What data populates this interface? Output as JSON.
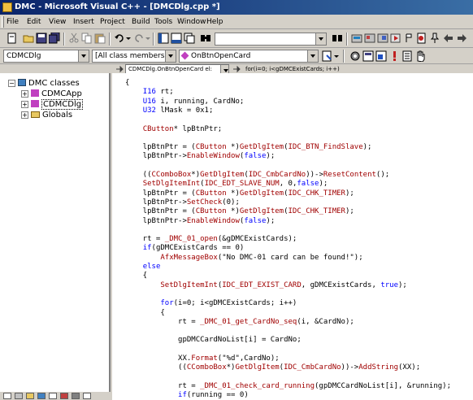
{
  "window": {
    "title": "DMC - Microsoft Visual C++ - [DMCDlg.cpp *]"
  },
  "menu": [
    "File",
    "Edit",
    "View",
    "Insert",
    "Project",
    "Build",
    "Tools",
    "Window",
    "Help"
  ],
  "wizard": {
    "class_combo": "CDMCDlg",
    "filter_combo": "[All class members]",
    "member_combo": "OnBtnOpenCard"
  },
  "tree": {
    "root": "DMC classes",
    "items": [
      "CDMCApp",
      "CDMCDlg",
      "Globals"
    ]
  },
  "navbar": {
    "scope": "CDMCDlg.OnBtnOpenCard el:",
    "context": "for(i=0; i<gDMCExistCards; i++)"
  },
  "code_lines": [
    "{",
    "    I16 rt;",
    "    U16 i, running, CardNo;",
    "    U32 lMask = 0x1;",
    "",
    "    CButton* lpBtnPtr;",
    "",
    "    lpBtnPtr = (CButton *)GetDlgItem(IDC_BTN_FindSlave);",
    "    lpBtnPtr->EnableWindow(false);",
    "",
    "    ((CComboBox*)GetDlgItem(IDC_CmbCardNo))->ResetContent();",
    "    SetDlgItemInt(IDC_EDT_SLAVE_NUM, 0,false);",
    "    lpBtnPtr = (CButton *)GetDlgItem(IDC_CHK_TIMER);",
    "    lpBtnPtr->SetCheck(0);",
    "    lpBtnPtr = (CButton *)GetDlgItem(IDC_CHK_TIMER);",
    "    lpBtnPtr->EnableWindow(false);",
    "",
    "    rt = _DMC_01_open(&gDMCExistCards);",
    "    if(gDMCExistCards == 0)",
    "        AfxMessageBox(\"No DMC-01 card can be found!\");",
    "    else",
    "    {",
    "        SetDlgItemInt(IDC_EDT_EXIST_CARD, gDMCExistCards, true);",
    "",
    "        for(i=0; i<gDMCExistCards; i++)",
    "        {",
    "            rt = _DMC_01_get_CardNo_seq(i, &CardNo);",
    "",
    "            gpDMCCardNoList[i] = CardNo;",
    "",
    "            XX.Format(\"%d\",CardNo);",
    "            ((CComboBox*)GetDlgItem(IDC_CmbCardNo))->AddString(XX);",
    "",
    "            rt = _DMC_01_check_card_running(gpDMCCardNoList[i], &running);",
    "            if(running == 0)"
  ],
  "colors": {
    "keyword": "#0000ff",
    "macro": "#a00000",
    "title_gradient_start": "#0a246a",
    "title_gradient_end": "#3a6ea5"
  }
}
